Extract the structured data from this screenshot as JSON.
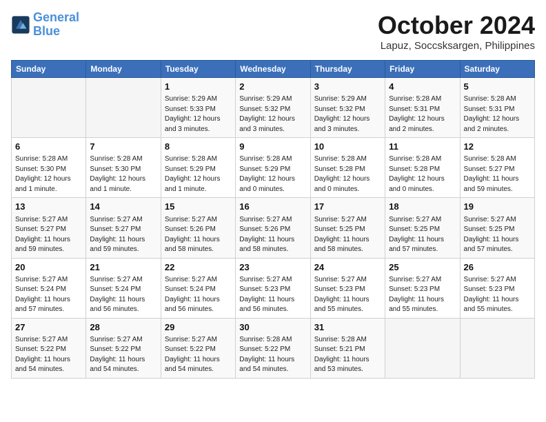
{
  "header": {
    "logo_line1": "General",
    "logo_line2": "Blue",
    "month": "October 2024",
    "location": "Lapuz, Soccsksargen, Philippines"
  },
  "days_of_week": [
    "Sunday",
    "Monday",
    "Tuesday",
    "Wednesday",
    "Thursday",
    "Friday",
    "Saturday"
  ],
  "weeks": [
    [
      {
        "day": "",
        "content": ""
      },
      {
        "day": "",
        "content": ""
      },
      {
        "day": "1",
        "content": "Sunrise: 5:29 AM\nSunset: 5:33 PM\nDaylight: 12 hours\nand 3 minutes."
      },
      {
        "day": "2",
        "content": "Sunrise: 5:29 AM\nSunset: 5:32 PM\nDaylight: 12 hours\nand 3 minutes."
      },
      {
        "day": "3",
        "content": "Sunrise: 5:29 AM\nSunset: 5:32 PM\nDaylight: 12 hours\nand 3 minutes."
      },
      {
        "day": "4",
        "content": "Sunrise: 5:28 AM\nSunset: 5:31 PM\nDaylight: 12 hours\nand 2 minutes."
      },
      {
        "day": "5",
        "content": "Sunrise: 5:28 AM\nSunset: 5:31 PM\nDaylight: 12 hours\nand 2 minutes."
      }
    ],
    [
      {
        "day": "6",
        "content": "Sunrise: 5:28 AM\nSunset: 5:30 PM\nDaylight: 12 hours\nand 1 minute."
      },
      {
        "day": "7",
        "content": "Sunrise: 5:28 AM\nSunset: 5:30 PM\nDaylight: 12 hours\nand 1 minute."
      },
      {
        "day": "8",
        "content": "Sunrise: 5:28 AM\nSunset: 5:29 PM\nDaylight: 12 hours\nand 1 minute."
      },
      {
        "day": "9",
        "content": "Sunrise: 5:28 AM\nSunset: 5:29 PM\nDaylight: 12 hours\nand 0 minutes."
      },
      {
        "day": "10",
        "content": "Sunrise: 5:28 AM\nSunset: 5:28 PM\nDaylight: 12 hours\nand 0 minutes."
      },
      {
        "day": "11",
        "content": "Sunrise: 5:28 AM\nSunset: 5:28 PM\nDaylight: 12 hours\nand 0 minutes."
      },
      {
        "day": "12",
        "content": "Sunrise: 5:28 AM\nSunset: 5:27 PM\nDaylight: 11 hours\nand 59 minutes."
      }
    ],
    [
      {
        "day": "13",
        "content": "Sunrise: 5:27 AM\nSunset: 5:27 PM\nDaylight: 11 hours\nand 59 minutes."
      },
      {
        "day": "14",
        "content": "Sunrise: 5:27 AM\nSunset: 5:27 PM\nDaylight: 11 hours\nand 59 minutes."
      },
      {
        "day": "15",
        "content": "Sunrise: 5:27 AM\nSunset: 5:26 PM\nDaylight: 11 hours\nand 58 minutes."
      },
      {
        "day": "16",
        "content": "Sunrise: 5:27 AM\nSunset: 5:26 PM\nDaylight: 11 hours\nand 58 minutes."
      },
      {
        "day": "17",
        "content": "Sunrise: 5:27 AM\nSunset: 5:25 PM\nDaylight: 11 hours\nand 58 minutes."
      },
      {
        "day": "18",
        "content": "Sunrise: 5:27 AM\nSunset: 5:25 PM\nDaylight: 11 hours\nand 57 minutes."
      },
      {
        "day": "19",
        "content": "Sunrise: 5:27 AM\nSunset: 5:25 PM\nDaylight: 11 hours\nand 57 minutes."
      }
    ],
    [
      {
        "day": "20",
        "content": "Sunrise: 5:27 AM\nSunset: 5:24 PM\nDaylight: 11 hours\nand 57 minutes."
      },
      {
        "day": "21",
        "content": "Sunrise: 5:27 AM\nSunset: 5:24 PM\nDaylight: 11 hours\nand 56 minutes."
      },
      {
        "day": "22",
        "content": "Sunrise: 5:27 AM\nSunset: 5:24 PM\nDaylight: 11 hours\nand 56 minutes."
      },
      {
        "day": "23",
        "content": "Sunrise: 5:27 AM\nSunset: 5:23 PM\nDaylight: 11 hours\nand 56 minutes."
      },
      {
        "day": "24",
        "content": "Sunrise: 5:27 AM\nSunset: 5:23 PM\nDaylight: 11 hours\nand 55 minutes."
      },
      {
        "day": "25",
        "content": "Sunrise: 5:27 AM\nSunset: 5:23 PM\nDaylight: 11 hours\nand 55 minutes."
      },
      {
        "day": "26",
        "content": "Sunrise: 5:27 AM\nSunset: 5:23 PM\nDaylight: 11 hours\nand 55 minutes."
      }
    ],
    [
      {
        "day": "27",
        "content": "Sunrise: 5:27 AM\nSunset: 5:22 PM\nDaylight: 11 hours\nand 54 minutes."
      },
      {
        "day": "28",
        "content": "Sunrise: 5:27 AM\nSunset: 5:22 PM\nDaylight: 11 hours\nand 54 minutes."
      },
      {
        "day": "29",
        "content": "Sunrise: 5:27 AM\nSunset: 5:22 PM\nDaylight: 11 hours\nand 54 minutes."
      },
      {
        "day": "30",
        "content": "Sunrise: 5:28 AM\nSunset: 5:22 PM\nDaylight: 11 hours\nand 54 minutes."
      },
      {
        "day": "31",
        "content": "Sunrise: 5:28 AM\nSunset: 5:21 PM\nDaylight: 11 hours\nand 53 minutes."
      },
      {
        "day": "",
        "content": ""
      },
      {
        "day": "",
        "content": ""
      }
    ]
  ]
}
